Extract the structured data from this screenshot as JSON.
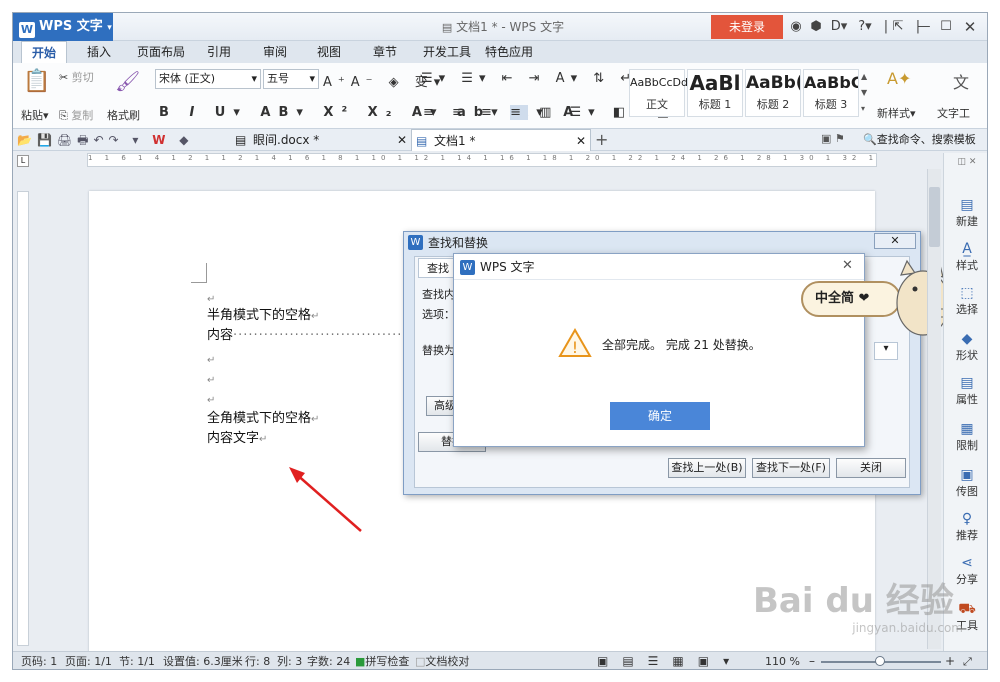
{
  "app": {
    "name": "WPS 文字",
    "window_title": "文档1 * - WPS 文字",
    "login_label": "未登录"
  },
  "tabs": [
    "开始",
    "插入",
    "页面布局",
    "引用",
    "审阅",
    "视图",
    "章节",
    "开发工具",
    "特色应用"
  ],
  "ribbon": {
    "paste": "粘贴",
    "cut": "剪切",
    "copy": "复制",
    "format_painter": "格式刷",
    "font_name": "宋体 (正文)",
    "font_size": "五号",
    "styles": [
      {
        "preview": "AaBbCcDd",
        "label": "正文"
      },
      {
        "preview": "AaBl",
        "label": "标题 1"
      },
      {
        "preview": "AaBb(",
        "label": "标题 2"
      },
      {
        "preview": "AaBbC",
        "label": "标题 3"
      }
    ],
    "new_style": "新样式",
    "text_tool": "文字工"
  },
  "quickbar": {
    "doc_tabs": [
      {
        "name": "眼间.docx *"
      },
      {
        "name": "文档1 *"
      }
    ],
    "search_placeholder": "查找命令、搜索模板"
  },
  "ruler_marks": "1 1 6 1 4 1 2 1 1 2 1 4 1 6 1 8 1 10 1 12 1 14 1 16 1 18 1 20 1 22 1 24 1 26 1 28 1 30 1 32 1 34 1 36 1 38 1 40 1 42 1 44 1 46 1",
  "document": {
    "lines": [
      "半角模式下的空格",
      "内容",
      "全角模式下的空格",
      "内容文字"
    ],
    "pmark": "↵"
  },
  "find_dialog": {
    "title": "查找和替换",
    "tab_find": "查找",
    "find_label": "查找内",
    "options_label": "选项：",
    "replace_label": "替换为",
    "advanced_btn": "高级",
    "replace_btn": "替换",
    "find_prev": "查找上一处(B)",
    "find_next": "查找下一处(F)",
    "close": "关闭"
  },
  "message_box": {
    "title": "WPS 文字",
    "message": "全部完成。 完成 21 处替换。",
    "ok": "确定"
  },
  "badge": {
    "text": "中全简 ❤"
  },
  "sidebar": [
    {
      "label": "新建",
      "icon": "new-doc-icon"
    },
    {
      "label": "样式",
      "icon": "style-icon"
    },
    {
      "label": "选择",
      "icon": "select-icon"
    },
    {
      "label": "形状",
      "icon": "shape-icon"
    },
    {
      "label": "属性",
      "icon": "properties-icon"
    },
    {
      "label": "限制",
      "icon": "restrict-icon"
    },
    {
      "label": "传图",
      "icon": "image-upload-icon"
    },
    {
      "label": "推荐",
      "icon": "recommend-icon"
    },
    {
      "label": "分享",
      "icon": "share-icon"
    },
    {
      "label": "工具",
      "icon": "toolbox-icon"
    }
  ],
  "statusbar": {
    "page_num": "页码: 1",
    "pages": "页面: 1/1",
    "section": "节: 1/1",
    "setting": "设置值: 6.3厘米",
    "row": "行: 8",
    "col": "列: 3",
    "words": "字数: 24",
    "spell": "拼写检查",
    "proof": "文档校对",
    "zoom": "110 %"
  },
  "watermark": {
    "brand": "Bai du 经验",
    "url": "jingyan.baidu.com"
  },
  "colors": {
    "accent": "#2f6fbf",
    "login": "#e3553b",
    "ok_button": "#4a86d8",
    "arrow": "#e02020"
  }
}
